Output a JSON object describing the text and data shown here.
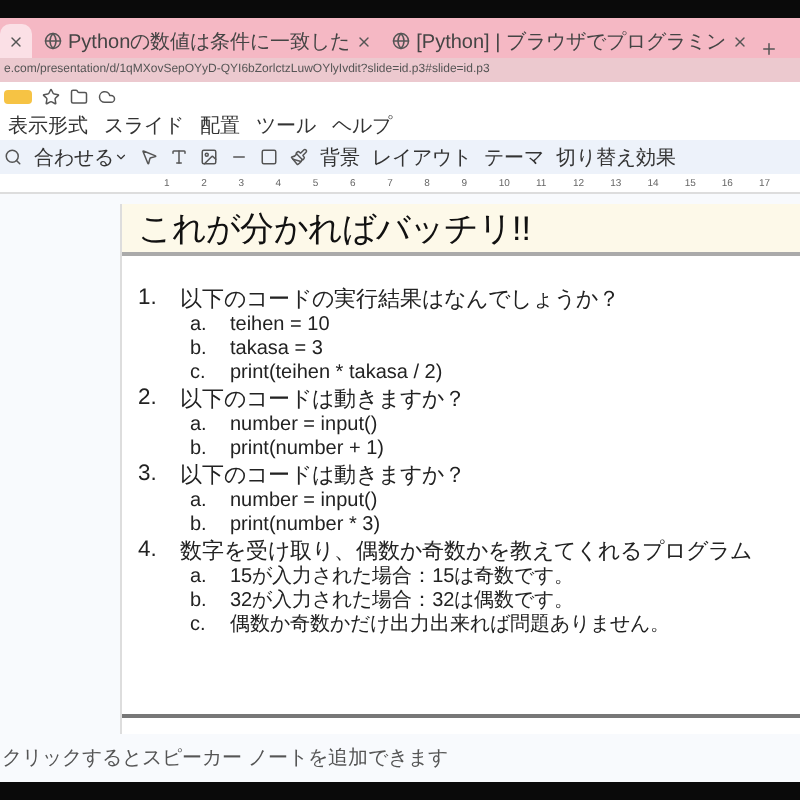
{
  "browser": {
    "tabs": [
      {
        "selected": true
      },
      {
        "title": "Pythonの数値は条件に一致した",
        "selected": false
      },
      {
        "title": "[Python] | ブラウザでプログラミン",
        "selected": false
      }
    ],
    "url": "e.com/presentation/d/1qMXovSepOYyD-QYI6bZorlctzLuwOYlyIvdit?slide=id.p3#slide=id.p3"
  },
  "menu": [
    "表示形式",
    "スライド",
    "配置",
    "ツール",
    "ヘルプ"
  ],
  "toolbar": {
    "zoom": "合わせる",
    "buttons": [
      "背景",
      "レイアウト",
      "テーマ",
      "切り替え効果"
    ]
  },
  "ruler": [
    "1",
    "2",
    "3",
    "4",
    "5",
    "6",
    "7",
    "8",
    "9",
    "10",
    "11",
    "12",
    "13",
    "14",
    "15",
    "16",
    "17"
  ],
  "slide": {
    "title": "これが分かればバッチリ!!",
    "items": [
      {
        "marker": "1.",
        "text": "以下のコードの実行結果はなんでしょうか？",
        "children": [
          {
            "marker": "a.",
            "text": "teihen = 10"
          },
          {
            "marker": "b.",
            "text": "takasa = 3"
          },
          {
            "marker": "c.",
            "text": "print(teihen * takasa / 2)"
          }
        ]
      },
      {
        "marker": "2.",
        "text": "以下のコードは動きますか？",
        "children": [
          {
            "marker": "a.",
            "text": "number = input()"
          },
          {
            "marker": "b.",
            "text": "print(number + 1)"
          }
        ]
      },
      {
        "marker": "3.",
        "text": "以下のコードは動きますか？",
        "children": [
          {
            "marker": "a.",
            "text": "number = input()"
          },
          {
            "marker": "b.",
            "text": "print(number * 3)"
          }
        ]
      },
      {
        "marker": "4.",
        "text": "数字を受け取り、偶数か奇数かを教えてくれるプログラム",
        "children": [
          {
            "marker": "a.",
            "text": "15が入力された場合：15は奇数です。"
          },
          {
            "marker": "b.",
            "text": "32が入力された場合：32は偶数です。"
          },
          {
            "marker": "c.",
            "text": "偶数か奇数かだけ出力出来れば問題ありません。"
          }
        ]
      }
    ]
  },
  "notes": "クリックするとスピーカー ノートを追加できます"
}
